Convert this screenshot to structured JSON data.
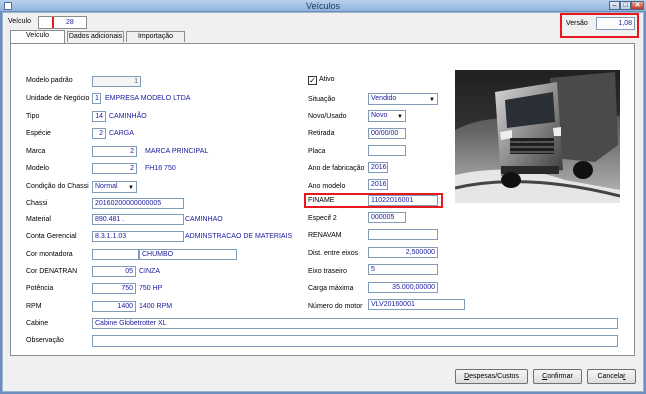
{
  "window": {
    "title": "Veículos",
    "minimize": "–",
    "maximize": "□",
    "close": "✕"
  },
  "header": {
    "veiculo_label": "Veículo",
    "veiculo_value": "28",
    "versao_label": "Versão",
    "versao_value": "1,08"
  },
  "tabs": [
    {
      "label": "Veículo"
    },
    {
      "label": "Dados adicionais"
    },
    {
      "label": "Importação"
    }
  ],
  "left": {
    "modelo_padrao": {
      "label": "Modelo padrão",
      "value": "1"
    },
    "unidade": {
      "label": "Unidade de Negócio",
      "code": "1",
      "name": "EMPRESA MODELO LTDA"
    },
    "tipo": {
      "label": "Tipo",
      "code": "14",
      "name": "CAMINHÃO"
    },
    "especie": {
      "label": "Espécie",
      "code": "2",
      "name": "CARGA"
    },
    "marca": {
      "label": "Marca",
      "code": "2",
      "name": "MARCA PRINCIPAL"
    },
    "modelo": {
      "label": "Modelo",
      "code": "2",
      "name": "FH16 750"
    },
    "condicao": {
      "label": "Condição do Chassi",
      "value": "Normal"
    },
    "chassi": {
      "label": "Chassi",
      "value": "20160200000000005"
    },
    "material": {
      "label": "Material",
      "code": "890.481 .",
      "name": "CAMINHAO"
    },
    "conta": {
      "label": "Conta Gerencial",
      "code": "8.3.1.1.03",
      "name": "ADMINSTRACAO DE MATERIAIS"
    },
    "cor_montadora": {
      "label": "Cor montadora",
      "code": "",
      "name": "CHUMBO"
    },
    "cor_denatran": {
      "label": "Cor DENATRAN",
      "code": "05",
      "name": "CINZA"
    },
    "potencia": {
      "label": "Potência",
      "code": "750",
      "name": "750 HP"
    },
    "rpm": {
      "label": "RPM",
      "code": "1400",
      "name": "1400 RPM"
    },
    "cabine": {
      "label": "Cabine",
      "value": "Cabine Globetrotter XL"
    },
    "observacao": {
      "label": "Observação",
      "value": ""
    }
  },
  "right": {
    "ativo": {
      "label": "Ativo",
      "checked": true
    },
    "situacao": {
      "label": "Situação",
      "value": "Vendido"
    },
    "novo_usado": {
      "label": "Novo/Usado",
      "value": "Novo"
    },
    "retirada": {
      "label": "Retirada",
      "value": "00/00/00"
    },
    "placa": {
      "label": "Placa",
      "value": ""
    },
    "ano_fab": {
      "label": "Ano de fabricação",
      "value": "2016"
    },
    "ano_modelo": {
      "label": "Ano modelo",
      "value": "2016"
    },
    "finame": {
      "label": "FINAME",
      "value": "11022016001"
    },
    "especif2": {
      "label": "Especif 2",
      "value": "000005"
    },
    "renavam": {
      "label": "RENAVAM",
      "value": ""
    },
    "dist_eixos": {
      "label": "Dist. entre eixos",
      "value": "2,500000"
    },
    "eixo_traseiro": {
      "label": "Eixo traseiro",
      "value": "5"
    },
    "carga_maxima": {
      "label": "Carga máxima",
      "value": "35.000,00000"
    },
    "numero_motor": {
      "label": "Número do motor",
      "value": "VLV20160001"
    }
  },
  "buttons": {
    "despesas": {
      "label": "Despesas/Custos",
      "mnemonic": "D",
      "rest": "espesas/Custos"
    },
    "confirmar": {
      "label": "Confirmar",
      "mnemonic": "C",
      "rest": "onfirmar"
    },
    "cancelar": {
      "label": "Cancelar",
      "mnemonic": "r",
      "pre": "Cancela"
    }
  },
  "colors": {
    "highlight": "#e8181e",
    "value_text": "#1a1aa0"
  },
  "icons": {
    "dropdown": "chevron-down-icon",
    "check": "checkmark-icon",
    "truck": "truck-photo"
  }
}
